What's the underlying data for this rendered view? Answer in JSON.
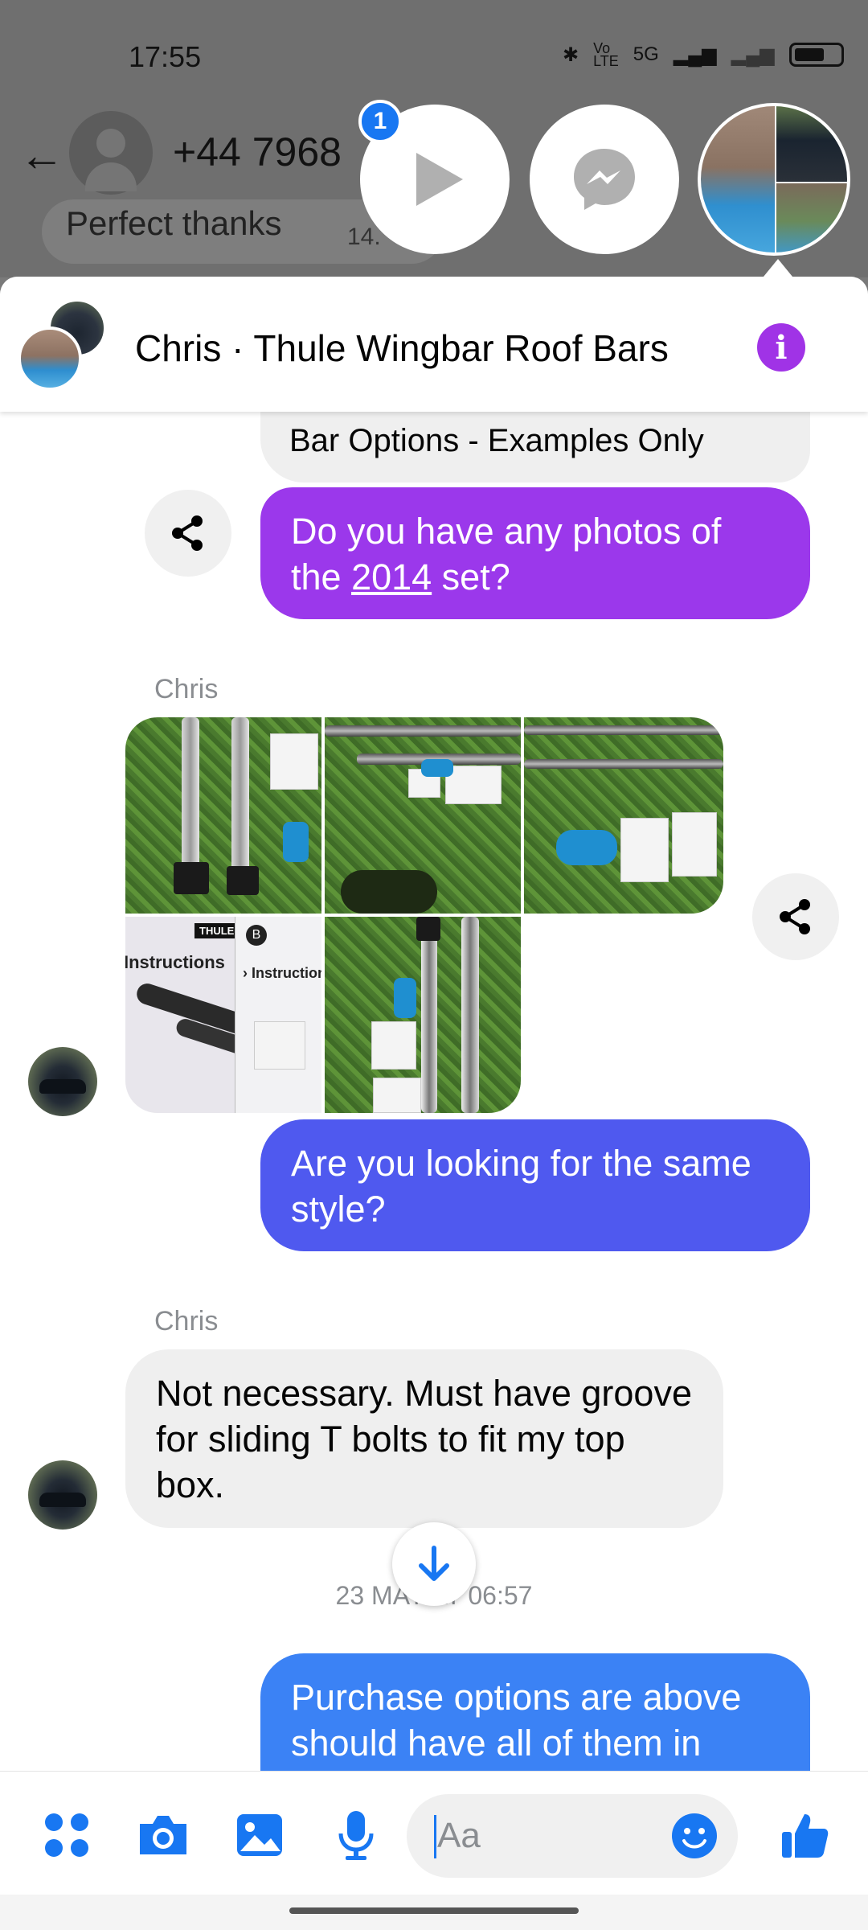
{
  "status_bar": {
    "time": "17:55",
    "network": "5G"
  },
  "background_chat": {
    "phone_number": "+44 7968",
    "bubble_text": "Perfect thanks",
    "bubble_time": "14."
  },
  "chat_heads": {
    "unread_badge": "1"
  },
  "header": {
    "title": "Chris · Thule Wingbar Roof Bars"
  },
  "messages": {
    "bar_options": "Bar Options - Examples Only",
    "question_prefix": "Do you have any photos of the ",
    "question_link": "2014",
    "question_suffix": " set?",
    "sender_1": "Chris",
    "same_style": "Are you looking for the same style?",
    "sender_2": "Chris",
    "reply": "Not necessary. Must have groove for sliding T bolts to fit my top box.",
    "date_separator": "23 MAY AT 06:57",
    "purchase_line1": "Purchase options are above",
    "purchase_line2": "should have all of them in"
  },
  "photos": {
    "instructions_brand": "THULE",
    "instructions_title": "Instructions",
    "instructions_title_2": "› Instructions"
  },
  "composer": {
    "placeholder": "Aa"
  },
  "colors": {
    "messenger_blue": "#1877f2",
    "purple_bubble": "#9b38eb",
    "indigo_bubble": "#4f59ef",
    "blue_bubble": "#3b82f5",
    "info_purple": "#a033e6"
  },
  "icons": [
    "back-arrow-icon",
    "play-icon",
    "messenger-icon",
    "info-icon",
    "share-icon",
    "arrow-down-icon",
    "apps-icon",
    "camera-icon",
    "gallery-icon",
    "microphone-icon",
    "emoji-icon",
    "thumbs-up-icon"
  ]
}
